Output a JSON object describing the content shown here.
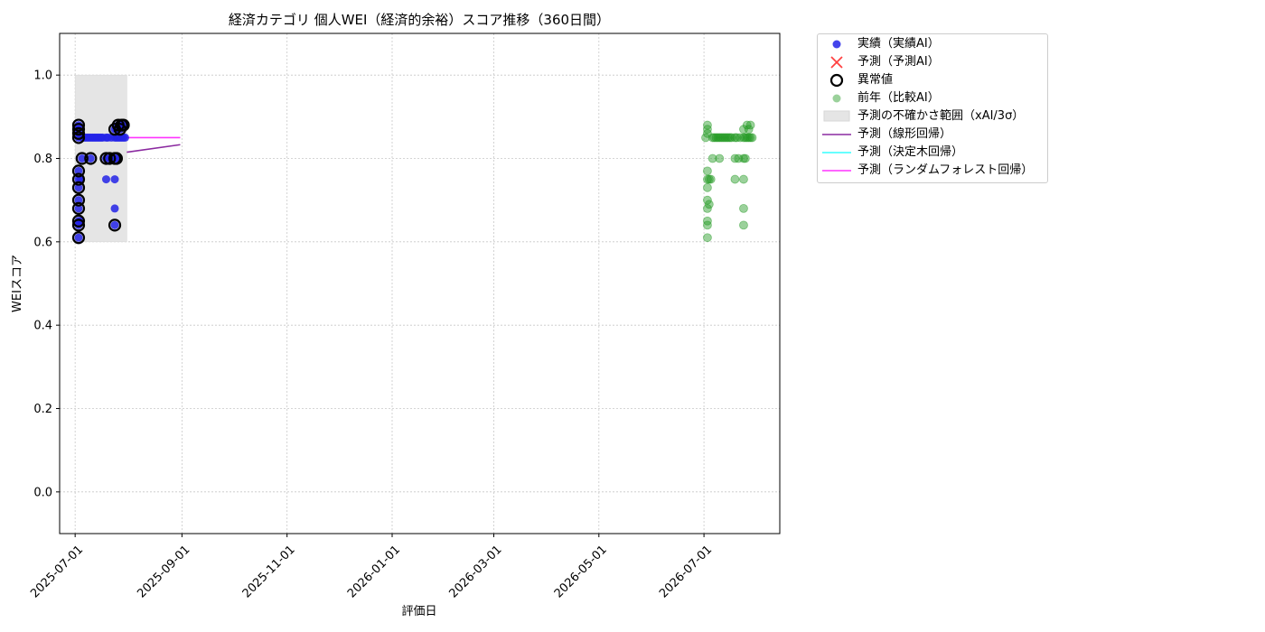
{
  "chart_data": {
    "type": "scatter",
    "title": "経済カテゴリ 個人WEI（経済的余裕）スコア推移（360日間）",
    "xlabel": "評価日",
    "ylabel": "WEIスコア",
    "xlim": [
      "2025-06-22",
      "2026-08-14"
    ],
    "ylim": [
      -0.1,
      1.1
    ],
    "grid": true,
    "x_ticks": [
      "2025-07-01",
      "2025-09-01",
      "2025-11-01",
      "2026-01-01",
      "2026-03-01",
      "2026-05-01",
      "2026-07-01"
    ],
    "y_ticks": [
      0.0,
      0.2,
      0.4,
      0.6,
      0.8,
      1.0
    ],
    "y_tick_labels": [
      "0.0",
      "0.2",
      "0.4",
      "0.6",
      "0.8",
      "1.0"
    ],
    "legend_position": "outside-upper-right",
    "uncertainty_band": {
      "x_start": "2025-07-01",
      "x_end": "2025-07-31",
      "y_low": 0.6,
      "y_high": 1.0,
      "color": "#e5e5e5"
    },
    "series": [
      {
        "name": "実績（実績AI）",
        "kind": "scatter",
        "color": "#2323e8",
        "points": [
          [
            "2025-07-03",
            0.61
          ],
          [
            "2025-07-03",
            0.64
          ],
          [
            "2025-07-03",
            0.65
          ],
          [
            "2025-07-03",
            0.68
          ],
          [
            "2025-07-03",
            0.7
          ],
          [
            "2025-07-03",
            0.73
          ],
          [
            "2025-07-03",
            0.75
          ],
          [
            "2025-07-03",
            0.77
          ],
          [
            "2025-07-03",
            0.85
          ],
          [
            "2025-07-03",
            0.86
          ],
          [
            "2025-07-03",
            0.87
          ],
          [
            "2025-07-03",
            0.88
          ],
          [
            "2025-07-04",
            0.65
          ],
          [
            "2025-07-04",
            0.75
          ],
          [
            "2025-07-05",
            0.8
          ],
          [
            "2025-07-05",
            0.85
          ],
          [
            "2025-07-06",
            0.85
          ],
          [
            "2025-07-07",
            0.85
          ],
          [
            "2025-07-08",
            0.85
          ],
          [
            "2025-07-09",
            0.85
          ],
          [
            "2025-07-10",
            0.8
          ],
          [
            "2025-07-10",
            0.85
          ],
          [
            "2025-07-11",
            0.85
          ],
          [
            "2025-07-12",
            0.85
          ],
          [
            "2025-07-13",
            0.85
          ],
          [
            "2025-07-14",
            0.85
          ],
          [
            "2025-07-15",
            0.85
          ],
          [
            "2025-07-16",
            0.85
          ],
          [
            "2025-07-17",
            0.85
          ],
          [
            "2025-07-19",
            0.8
          ],
          [
            "2025-07-19",
            0.85
          ],
          [
            "2025-07-19",
            0.75
          ],
          [
            "2025-07-20",
            0.85
          ],
          [
            "2025-07-21",
            0.8
          ],
          [
            "2025-07-22",
            0.85
          ],
          [
            "2025-07-24",
            0.64
          ],
          [
            "2025-07-24",
            0.68
          ],
          [
            "2025-07-24",
            0.75
          ],
          [
            "2025-07-24",
            0.8
          ],
          [
            "2025-07-24",
            0.85
          ],
          [
            "2025-07-24",
            0.87
          ],
          [
            "2025-07-25",
            0.8
          ],
          [
            "2025-07-25",
            0.85
          ],
          [
            "2025-07-25",
            0.87
          ],
          [
            "2025-07-26",
            0.85
          ],
          [
            "2025-07-26",
            0.88
          ],
          [
            "2025-07-27",
            0.85
          ],
          [
            "2025-07-27",
            0.87
          ],
          [
            "2025-07-28",
            0.85
          ],
          [
            "2025-07-28",
            0.88
          ],
          [
            "2025-07-29",
            0.85
          ],
          [
            "2025-07-29",
            0.88
          ],
          [
            "2025-07-30",
            0.85
          ]
        ]
      },
      {
        "name": "予測（予測AI）",
        "kind": "marker-x",
        "color": "#ff4040",
        "points": []
      },
      {
        "name": "異常値",
        "kind": "ring",
        "color": "#000000",
        "points": [
          [
            "2025-07-03",
            0.61
          ],
          [
            "2025-07-03",
            0.64
          ],
          [
            "2025-07-03",
            0.65
          ],
          [
            "2025-07-03",
            0.68
          ],
          [
            "2025-07-03",
            0.7
          ],
          [
            "2025-07-03",
            0.73
          ],
          [
            "2025-07-03",
            0.75
          ],
          [
            "2025-07-03",
            0.77
          ],
          [
            "2025-07-03",
            0.85
          ],
          [
            "2025-07-03",
            0.86
          ],
          [
            "2025-07-03",
            0.87
          ],
          [
            "2025-07-03",
            0.88
          ],
          [
            "2025-07-05",
            0.8
          ],
          [
            "2025-07-10",
            0.8
          ],
          [
            "2025-07-19",
            0.8
          ],
          [
            "2025-07-21",
            0.8
          ],
          [
            "2025-07-24",
            0.64
          ],
          [
            "2025-07-24",
            0.8
          ],
          [
            "2025-07-24",
            0.87
          ],
          [
            "2025-07-25",
            0.8
          ],
          [
            "2025-07-26",
            0.88
          ],
          [
            "2025-07-27",
            0.87
          ],
          [
            "2025-07-28",
            0.88
          ],
          [
            "2025-07-29",
            0.88
          ]
        ]
      },
      {
        "name": "前年（比較AI）",
        "kind": "scatter-alpha",
        "color": "#229922",
        "points": [
          [
            "2026-07-02",
            0.85
          ],
          [
            "2026-07-03",
            0.61
          ],
          [
            "2026-07-03",
            0.64
          ],
          [
            "2026-07-03",
            0.65
          ],
          [
            "2026-07-03",
            0.68
          ],
          [
            "2026-07-03",
            0.7
          ],
          [
            "2026-07-03",
            0.73
          ],
          [
            "2026-07-03",
            0.75
          ],
          [
            "2026-07-03",
            0.77
          ],
          [
            "2026-07-03",
            0.86
          ],
          [
            "2026-07-03",
            0.87
          ],
          [
            "2026-07-03",
            0.88
          ],
          [
            "2026-07-04",
            0.75
          ],
          [
            "2026-07-04",
            0.69
          ],
          [
            "2026-07-05",
            0.75
          ],
          [
            "2026-07-06",
            0.8
          ],
          [
            "2026-07-06",
            0.85
          ],
          [
            "2026-07-07",
            0.85
          ],
          [
            "2026-07-08",
            0.85
          ],
          [
            "2026-07-09",
            0.85
          ],
          [
            "2026-07-10",
            0.8
          ],
          [
            "2026-07-10",
            0.85
          ],
          [
            "2026-07-11",
            0.85
          ],
          [
            "2026-07-12",
            0.85
          ],
          [
            "2026-07-13",
            0.85
          ],
          [
            "2026-07-14",
            0.85
          ],
          [
            "2026-07-15",
            0.85
          ],
          [
            "2026-07-16",
            0.85
          ],
          [
            "2026-07-17",
            0.85
          ],
          [
            "2026-07-19",
            0.75
          ],
          [
            "2026-07-19",
            0.8
          ],
          [
            "2026-07-19",
            0.85
          ],
          [
            "2026-07-20",
            0.85
          ],
          [
            "2026-07-21",
            0.8
          ],
          [
            "2026-07-22",
            0.85
          ],
          [
            "2026-07-24",
            0.64
          ],
          [
            "2026-07-24",
            0.68
          ],
          [
            "2026-07-24",
            0.75
          ],
          [
            "2026-07-24",
            0.8
          ],
          [
            "2026-07-24",
            0.85
          ],
          [
            "2026-07-24",
            0.87
          ],
          [
            "2026-07-25",
            0.8
          ],
          [
            "2026-07-25",
            0.85
          ],
          [
            "2026-07-26",
            0.85
          ],
          [
            "2026-07-26",
            0.88
          ],
          [
            "2026-07-27",
            0.85
          ],
          [
            "2026-07-27",
            0.87
          ],
          [
            "2026-07-28",
            0.85
          ],
          [
            "2026-07-28",
            0.88
          ],
          [
            "2026-07-29",
            0.85
          ]
        ]
      },
      {
        "name": "予測（線形回帰）",
        "kind": "line",
        "color": "#8b2aa0",
        "points": [
          [
            "2025-07-31",
            0.815
          ],
          [
            "2025-08-31",
            0.833
          ]
        ]
      },
      {
        "name": "予測（決定木回帰）",
        "kind": "line",
        "color": "#33ffff",
        "points": []
      },
      {
        "name": "予測（ランダムフォレスト回帰）",
        "kind": "line",
        "color": "#ff33ff",
        "points": [
          [
            "2025-07-31",
            0.85
          ],
          [
            "2025-08-31",
            0.85
          ]
        ]
      }
    ],
    "legend_entries": [
      {
        "label": "実績（実績AI）",
        "symbol": "dot",
        "color": "#2323e8"
      },
      {
        "label": "予測（予測AI）",
        "symbol": "x",
        "color": "#ff4040"
      },
      {
        "label": "異常値",
        "symbol": "ring",
        "color": "#000000"
      },
      {
        "label": "前年（比較AI）",
        "symbol": "dot-alpha",
        "color": "#229922"
      },
      {
        "label": "予測の不確かさ範囲（xAI/3σ）",
        "symbol": "patch",
        "color": "#e5e5e5"
      },
      {
        "label": "予測（線形回帰）",
        "symbol": "line",
        "color": "#8b2aa0"
      },
      {
        "label": "予測（決定木回帰）",
        "symbol": "line",
        "color": "#33ffff"
      },
      {
        "label": "予測（ランダムフォレスト回帰）",
        "symbol": "line",
        "color": "#ff33ff"
      }
    ]
  }
}
